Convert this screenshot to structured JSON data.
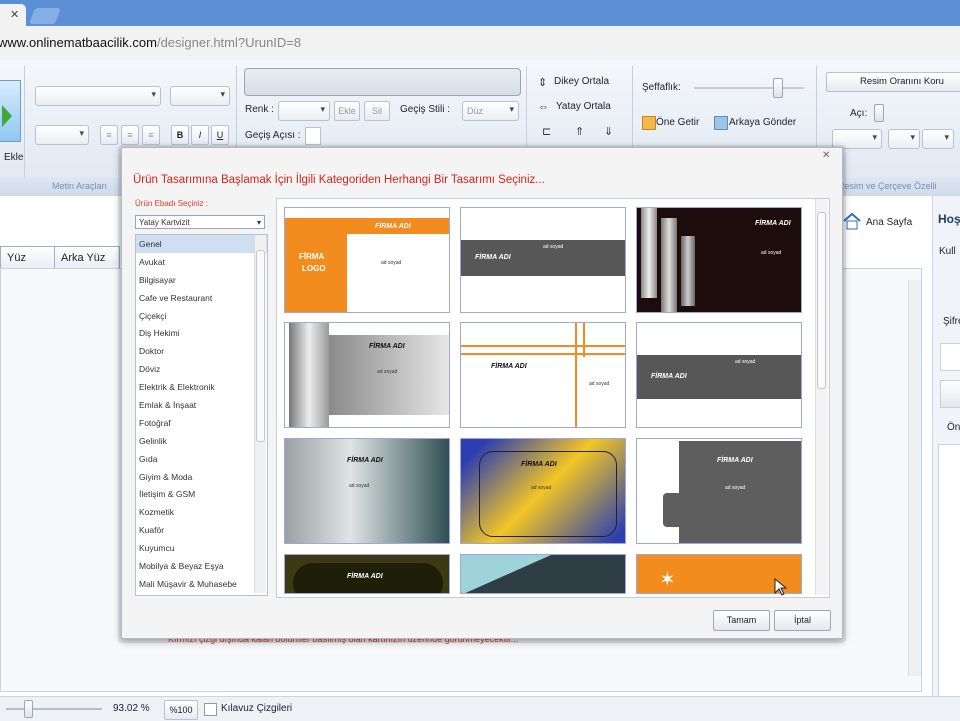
{
  "browser": {
    "url_host": "www.onlinematbaacilik.com",
    "url_path": "/designer.html?UrunID=8",
    "tab_close": "✕"
  },
  "ribbon": {
    "ekle_label": "Ekle",
    "metin_group": "Metin Araçları",
    "cerceve_group": "Resim ve Çerçeve Özelli",
    "renk_label": "Renk :",
    "ekle_btn": "Ekle",
    "sil_btn": "Sil",
    "gecis_stili_label": "Geçiş Stili :",
    "gecis_stili_value": "Düz",
    "gecis_acisi_label": "Geçiş Açısı :",
    "dikey_ortala": "Dikey Ortala",
    "yatay_ortala": "Yatay Ortala",
    "seffaflik_label": "Şeffaflık:",
    "one_getir": "Öne Getir",
    "arkaya_gonder": "Arkaya Gönder",
    "resim_oranini": "Resim Oranını Koru",
    "aci_label": "Açı:",
    "bold": "B",
    "italic": "I",
    "underline": "U"
  },
  "page": {
    "tab_front": "Yüz",
    "tab_back": "Arka Yüz",
    "home_link": "Ana Sayfa",
    "right_header": "Hoş",
    "right_kull": "Kull",
    "right_sifre": "Şifre",
    "right_on": "Ön",
    "warning": "Kırmızı çizgi dışında kalan bölümler basılmış olan kartınızın üzerinde görünmeyecektir...",
    "zoom_value": "93.02 %",
    "zoom_reset": "%100",
    "guides_label": "Kılavuz Çizgileri"
  },
  "modal": {
    "title": "Ürün Tasarımına Başlamak İçin İlgili Kategoriden Herhangi Bir Tasarımı Seçiniz...",
    "category_label": "Ürün Ebadı Seçiniz :",
    "size_selected": "Yatay Kartvizit",
    "categories": [
      "Genel",
      "Avukat",
      "Bilgisayar",
      "Cafe ve Restaurant",
      "Çiçekçi",
      "Diş Hekimi",
      "Doktor",
      "Döviz",
      "Elektrik & Elektronik",
      "Emlak & İnşaat",
      "Fotoğraf",
      "Gelinlik",
      "Gıda",
      "Giyim & Moda",
      "İletişim & GSM",
      "Kozmetik",
      "Kuaför",
      "Kuyumcu",
      "Mobilya & Beyaz Eşya",
      "Mali Müşavir & Muhasebe"
    ],
    "ok_button": "Tamam",
    "cancel_button": "İptal",
    "card_firm": "FİRMA ADI",
    "card_logo_line1": "FİRMA",
    "card_logo_line2": "LOGO",
    "card_name": "ad soyad",
    "card_title": "ünvan"
  }
}
